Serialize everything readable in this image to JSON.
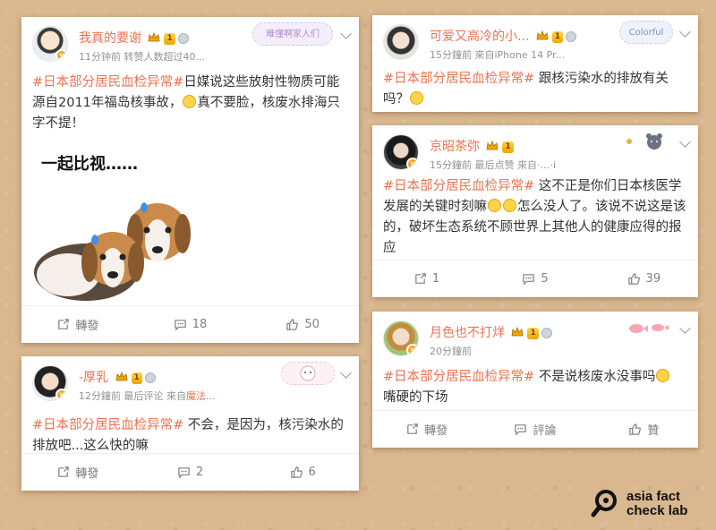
{
  "posts": [
    {
      "username": "我真的要谢",
      "badge": "1",
      "meta": "11分钟前 转赞人数超过40...",
      "hashtag": "#日本部分居民血检异常#",
      "text_a": "日媒说这些放射性物质可能源自2011年福岛核事故，",
      "text_b": "真不要脸，核废水排海只字不提！",
      "image_caption": "一起比视……",
      "deco": "难懂啊家人们",
      "repost": "轉發",
      "comments": "18",
      "likes": "50"
    },
    {
      "username": "可爱又高冷的小...",
      "badge": "1",
      "meta": "15分鐘前  來自iPhone 14 Pr...",
      "hashtag": "#日本部分居民血检异常#",
      "text_a": " 跟核污染水的排放有关吗？",
      "deco": "Colorful"
    },
    {
      "username": "京昭茶弥",
      "badge": "1",
      "meta": "15分鐘前  最后点赞  來自·…·i",
      "hashtag": "#日本部分居民血检异常#",
      "text_a": " 这不正是你们日本核医学发展的关键时刻嘛",
      "text_b": "怎么没人了。该说不说这是该的，破坏生态系统不顾世界上其他人的健康应得的报应",
      "reposts": "1",
      "comments": "5",
      "likes": "39"
    },
    {
      "username": "-厚乳",
      "badge": "1",
      "meta_a": "12分鐘前  最后评论  來自",
      "meta_src": "魔法...",
      "hashtag": "#日本部分居民血检异常#",
      "text_a": " 不会，是因为，核污染水的排放吧...这么快的嘛",
      "repost": "轉發",
      "comments": "2",
      "likes": "6"
    },
    {
      "username": "月色也不打烊",
      "badge": "1",
      "meta": "20分鐘前",
      "hashtag": "#日本部分居民血检异常#",
      "text_a": " 不是说核废水没事吗",
      "text_b": "嘴硬的下场",
      "repost": "轉發",
      "comment": "評論",
      "like": "贊"
    }
  ],
  "logo": {
    "line1": "asia fact",
    "line2": "check lab"
  },
  "colors": {
    "accent": "#eb7350",
    "background": "#d9b78f",
    "gold": "#f7a21b"
  }
}
